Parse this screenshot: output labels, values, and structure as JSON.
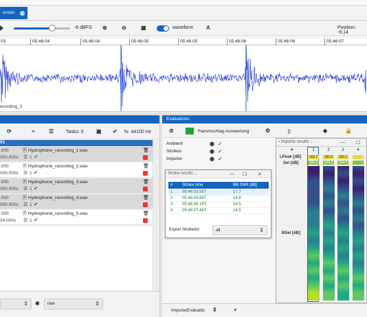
{
  "tab": {
    "label": "ession"
  },
  "toolbar": {
    "volume_label": "-6 dBFS",
    "waveform_label": "waveform",
    "a_label": "A",
    "position_label": "Position: -9.14"
  },
  "timeline": {
    "ticks": [
      "03",
      "05:46:04",
      "05:46:04",
      "05:46:05",
      "05:46:05",
      "05:46:06",
      "05:46:06",
      "05:46:07"
    ]
  },
  "waveform": {
    "caption": "ecording_3"
  },
  "left_panel": {
    "tasks_label": "Tasks: 0",
    "fs_label": "fs: 44100 Hz",
    "group_label": "01",
    "files": [
      {
        "name": "Hydrophone_recording_1.wav",
        "top_value": ".000",
        "bottom_value": "000.000s",
        "count": "1"
      },
      {
        "name": "Hydrophone_recording_2.wav",
        "top_value": ".000",
        "bottom_value": "000.000s",
        "count": "1"
      },
      {
        "name": "Hydrophone_recording_3.wav",
        "top_value": ".000",
        "bottom_value": "000.000s",
        "count": "1"
      },
      {
        "name": "Hydrophone_recording_4.wav",
        "top_value": ".000",
        "bottom_value": "000.000s",
        "count": "1"
      },
      {
        "name": "Hydrophone_recording_5.wav",
        "top_value": ".000",
        "bottom_value": "34.000s",
        "count": "1"
      }
    ],
    "format_select": "raw"
  },
  "evaluations": {
    "header": "Evaluations",
    "method": "Rammschlag-Auswertung",
    "bracket_icon": "[]",
    "rows": [
      "Ambient",
      "Strokes",
      "Impulse"
    ],
    "bottom_select": "ImpulseEvaluatic",
    "add_label": "+"
  },
  "strokes_window": {
    "title": "Stroke results ...",
    "columns": [
      "#",
      "Stroke time",
      "BB SNR [dB]"
    ],
    "rows": [
      {
        "n": "1",
        "time": "05:46:03.597",
        "snr": "17.7"
      },
      {
        "n": "2",
        "time": "05:46:04.897",
        "snr": "14.8"
      },
      {
        "n": "3",
        "time": "05:46:06.197",
        "snr": "14.5"
      },
      {
        "n": "4",
        "time": "05:46:07.447",
        "snr": "14.5"
      }
    ],
    "export_label": "Export Strokelist:",
    "export_value": "all"
  },
  "impulse_window": {
    "title": "Impulse results ...",
    "hash": "#",
    "columns": [
      "1",
      "2",
      "3",
      "4"
    ],
    "lpeak_label": "LPeak [dB]",
    "sel_label": "Sel [dB]",
    "bsel_label": "BSel [dB]",
    "lpeak_values": [
      "183.7",
      "183.2",
      "183.2",
      ""
    ],
    "sel_values": [
      "159.0",
      "159.2",
      "159.2",
      ""
    ]
  },
  "colors": {
    "accent": "#1565c0",
    "green": "#1aa33a",
    "waveform": "#1a2fd1"
  }
}
